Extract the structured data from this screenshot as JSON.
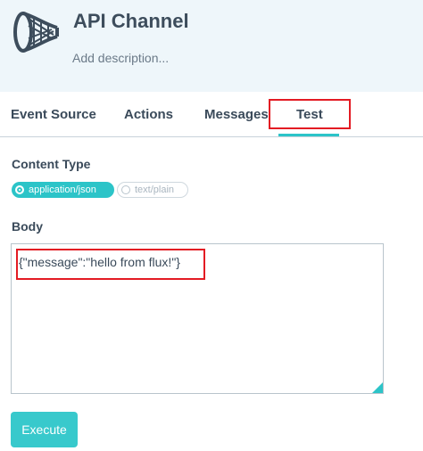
{
  "header": {
    "title": "API Channel",
    "description_placeholder": "Add description...",
    "icon": "api-channel-net-icon"
  },
  "tabs": [
    {
      "label": "Event Source",
      "active": false
    },
    {
      "label": "Actions",
      "active": false
    },
    {
      "label": "Messages",
      "active": false
    },
    {
      "label": "Test",
      "active": true
    }
  ],
  "content_type": {
    "label": "Content Type",
    "options": [
      {
        "label": "application/json",
        "selected": true
      },
      {
        "label": "text/plain",
        "selected": false
      }
    ]
  },
  "body": {
    "label": "Body",
    "value": "{\"message\":\"hello from flux!\"}"
  },
  "execute_label": "Execute",
  "colors": {
    "accent": "#2cc4c8",
    "highlight": "#e31b23",
    "header_bg": "#eef6fa"
  }
}
